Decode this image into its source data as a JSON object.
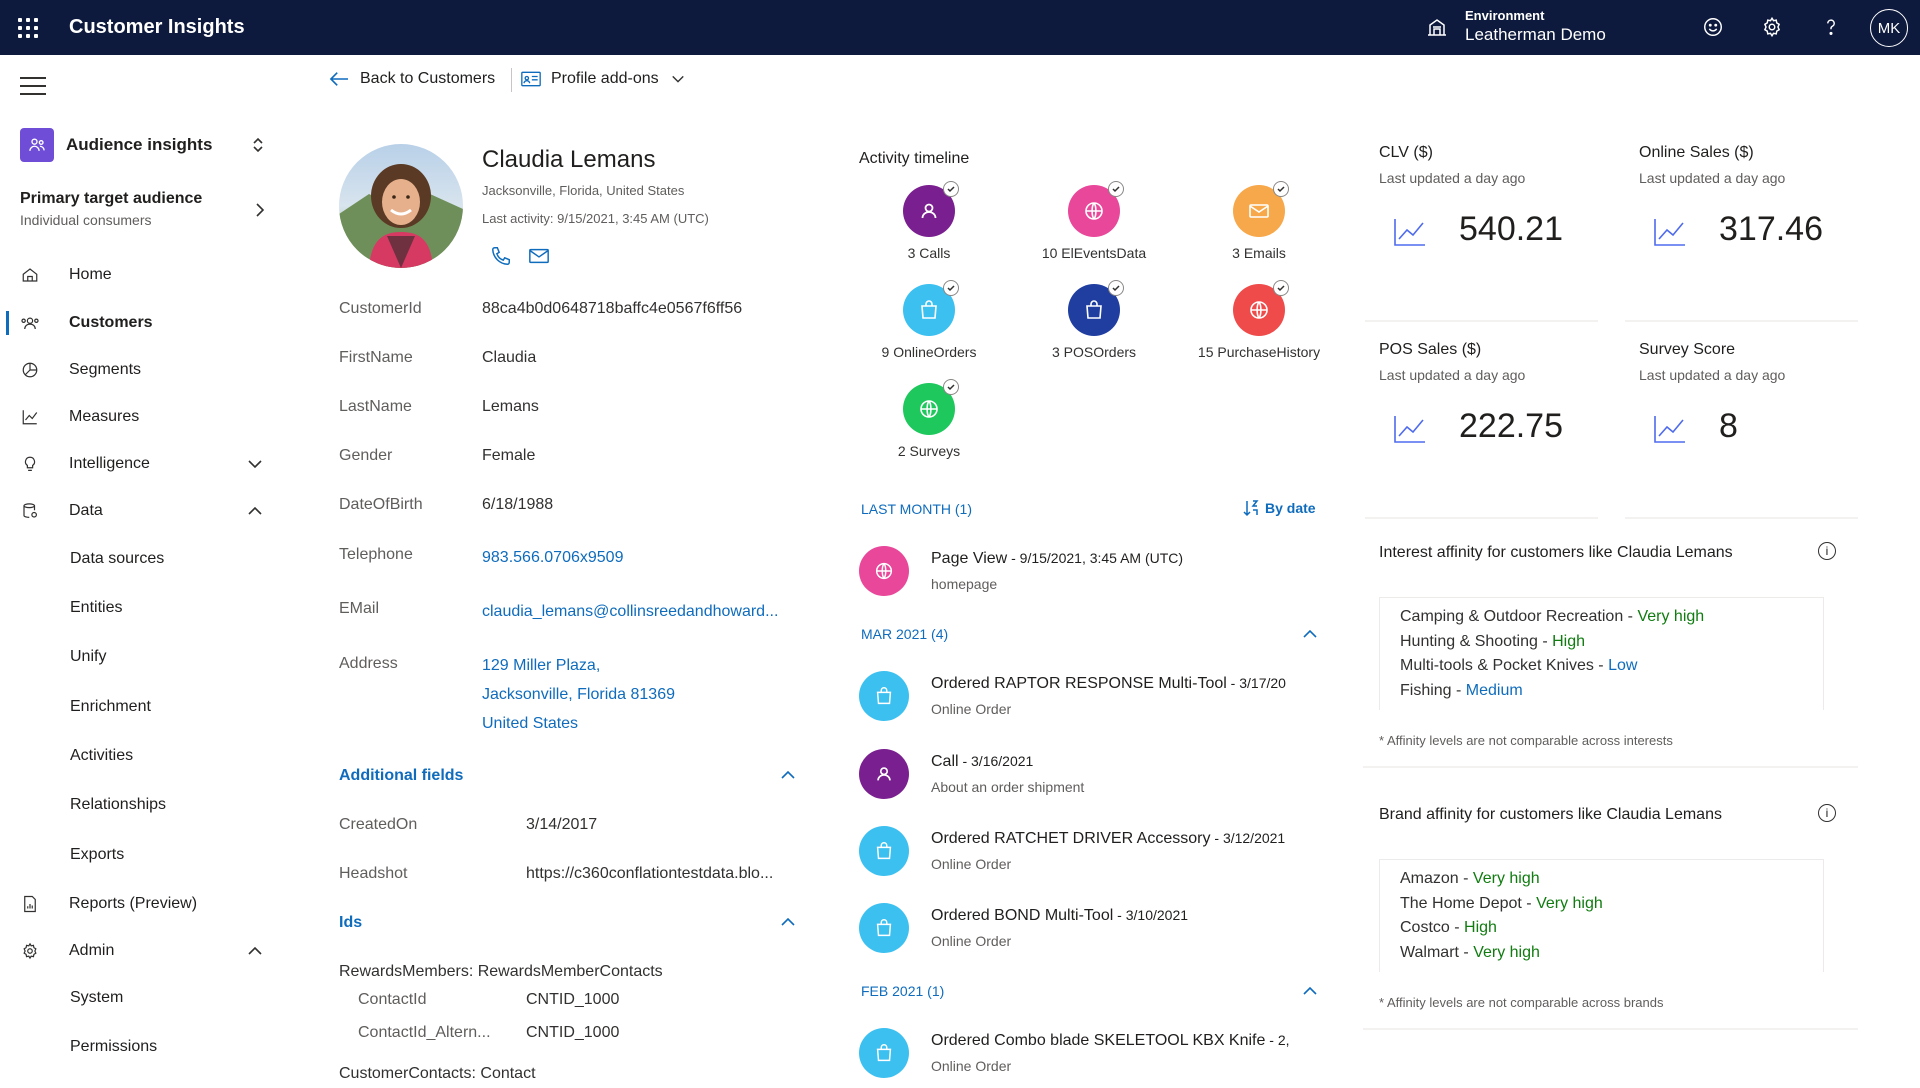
{
  "header": {
    "app_title": "Customer Insights",
    "env_label": "Environment",
    "env_name": "Leatherman Demo",
    "user_initials": "MK"
  },
  "sidebar": {
    "audience_label": "Audience insights",
    "primary_title": "Primary target audience",
    "primary_sub": "Individual consumers",
    "items": [
      {
        "label": "Home"
      },
      {
        "label": "Customers"
      },
      {
        "label": "Segments"
      },
      {
        "label": "Measures"
      },
      {
        "label": "Intelligence"
      },
      {
        "label": "Data"
      },
      {
        "label": "Reports (Preview)"
      },
      {
        "label": "Admin"
      }
    ],
    "data_sub": [
      "Data sources",
      "Entities",
      "Unify",
      "Enrichment",
      "Activities",
      "Relationships",
      "Exports"
    ],
    "admin_sub": [
      "System",
      "Permissions"
    ]
  },
  "toolbar": {
    "back_label": "Back to Customers",
    "addons_label": "Profile add-ons"
  },
  "profile": {
    "name": "Claudia Lemans",
    "location": "Jacksonville, Florida, United States",
    "last_activity": "Last activity: 9/15/2021, 3:45 AM (UTC)",
    "fields": [
      {
        "label": "CustomerId",
        "value": "88ca4b0d0648718baffc4e0567f6ff56"
      },
      {
        "label": "FirstName",
        "value": "Claudia"
      },
      {
        "label": "LastName",
        "value": "Lemans"
      },
      {
        "label": "Gender",
        "value": "Female"
      },
      {
        "label": "DateOfBirth",
        "value": "6/18/1988"
      },
      {
        "label": "Telephone",
        "value": "983.566.0706x9509"
      },
      {
        "label": "EMail",
        "value": "claudia_lemans@collinsreedandhoward..."
      },
      {
        "label": "Address",
        "value": ""
      }
    ],
    "address_lines": [
      "129 Miller Plaza,",
      "Jacksonville, Florida 81369",
      "United States"
    ],
    "additional_fields_title": "Additional fields",
    "additional_fields": [
      {
        "label": "CreatedOn",
        "value": "3/14/2017"
      },
      {
        "label": "Headshot",
        "value": "https://c360conflationtestdata.blo..."
      }
    ],
    "ids_title": "Ids",
    "ids_group": "RewardsMembers: RewardsMemberContacts",
    "ids": [
      {
        "label": "ContactId",
        "value": "CNTID_1000"
      },
      {
        "label": "ContactId_Altern...",
        "value": "CNTID_1000"
      }
    ],
    "ids_group2": "CustomerContacts: Contact"
  },
  "timeline": {
    "title": "Activity timeline",
    "tiles": [
      {
        "label": "3 Calls",
        "color": "#7a1f8f"
      },
      {
        "label": "10 ElEventsData",
        "color": "#e8479a"
      },
      {
        "label": "3 Emails",
        "color": "#f7a84a"
      },
      {
        "label": "9 OnlineOrders",
        "color": "#3cc0f0"
      },
      {
        "label": "3 POSOrders",
        "color": "#1f3ea0"
      },
      {
        "label": "15 PurchaseHistory",
        "color": "#ef4b4b"
      },
      {
        "label": "2 Surveys",
        "color": "#1ec85c"
      }
    ],
    "sort_label": "By date",
    "groups": [
      {
        "label": "LAST MONTH (1)"
      },
      {
        "label": "MAR 2021 (4)"
      },
      {
        "label": "FEB 2021 (1)"
      }
    ],
    "activities": [
      {
        "title": "Page View",
        "date": "9/15/2021, 3:45 AM (UTC)",
        "sub": "homepage"
      },
      {
        "title": "Ordered RAPTOR RESPONSE Multi-Tool",
        "date": "3/17/20",
        "sub": "Online Order"
      },
      {
        "title": "Call",
        "date": "3/16/2021",
        "sub": "About an order shipment"
      },
      {
        "title": "Ordered RATCHET DRIVER Accessory",
        "date": "3/12/2021",
        "sub": "Online Order"
      },
      {
        "title": "Ordered BOND Multi-Tool",
        "date": "3/10/2021",
        "sub": "Online Order"
      },
      {
        "title": "Ordered Combo blade SKELETOOL KBX Knife",
        "date": "2,",
        "sub": "Online Order"
      }
    ]
  },
  "kpis": [
    {
      "title": "CLV ($)",
      "updated": "Last updated a day ago",
      "value": "540.21"
    },
    {
      "title": "Online Sales ($)",
      "updated": "Last updated a day ago",
      "value": "317.46"
    },
    {
      "title": "POS Sales ($)",
      "updated": "Last updated a day ago",
      "value": "222.75"
    },
    {
      "title": "Survey Score",
      "updated": "Last updated a day ago",
      "value": "8"
    }
  ],
  "interest_affinity": {
    "title": "Interest affinity for customers like Claudia Lemans",
    "rows": [
      {
        "name": "Camping & Outdoor Recreation",
        "level": "Very high"
      },
      {
        "name": "Hunting & Shooting",
        "level": "High"
      },
      {
        "name": "Multi-tools & Pocket Knives",
        "level": "Low"
      },
      {
        "name": "Fishing",
        "level": "Medium"
      }
    ],
    "note": "* Affinity levels are not comparable across interests"
  },
  "brand_affinity": {
    "title": "Brand affinity for customers like Claudia Lemans",
    "rows": [
      {
        "name": "Amazon",
        "level": "Very high"
      },
      {
        "name": "The Home Depot",
        "level": "Very high"
      },
      {
        "name": "Costco",
        "level": "High"
      },
      {
        "name": "Walmart",
        "level": "Very high"
      }
    ],
    "note": "* Affinity levels are not comparable across brands"
  }
}
